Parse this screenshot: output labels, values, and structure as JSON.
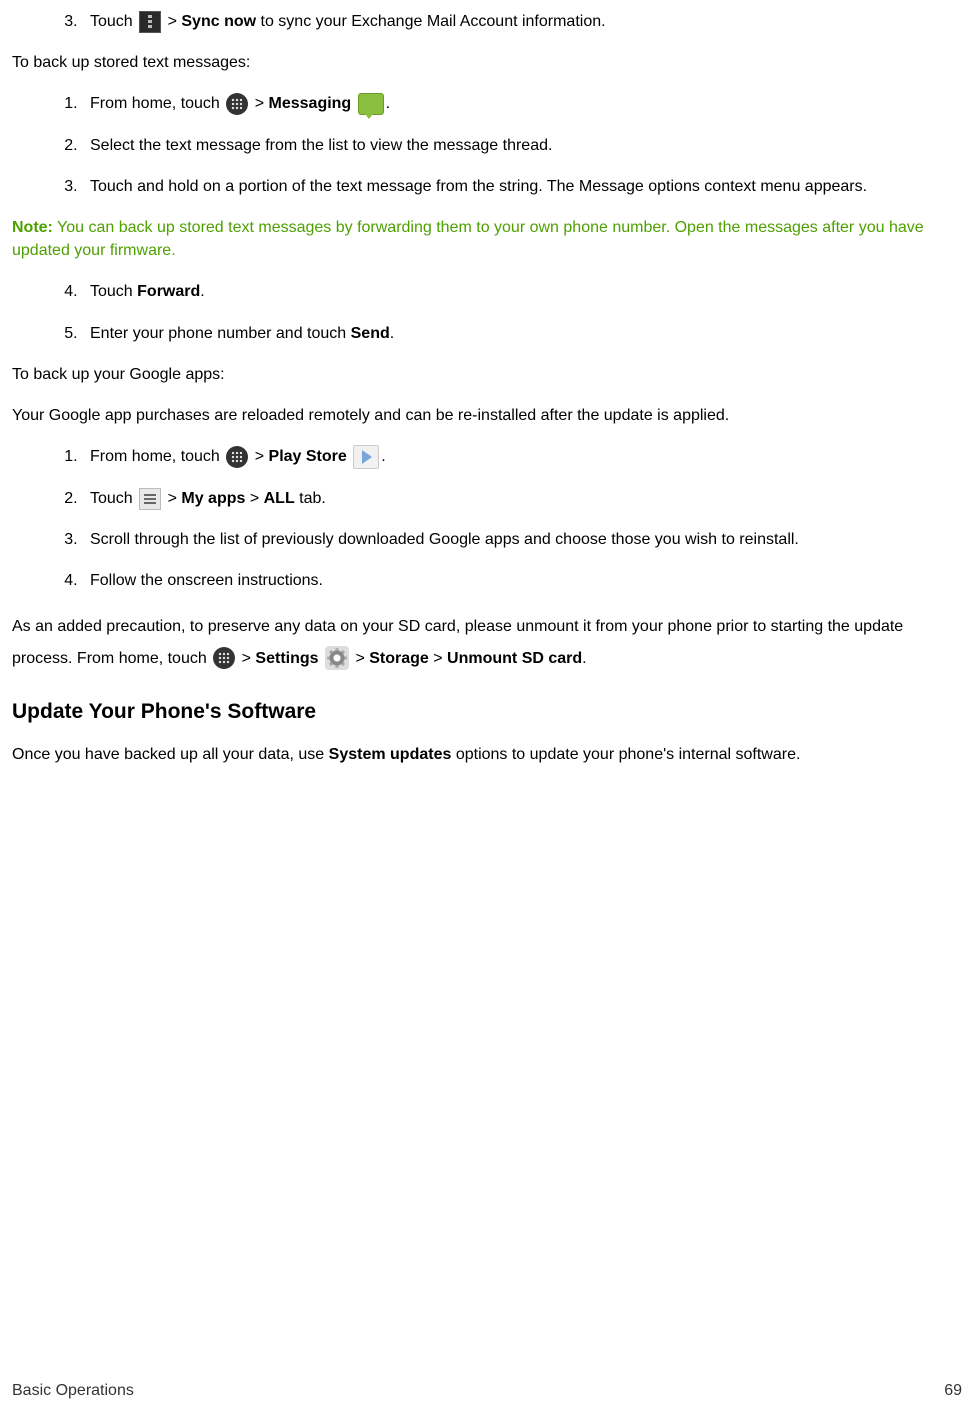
{
  "list1": {
    "start": 3,
    "item3_a": "Touch ",
    "item3_b": " > ",
    "item3_sync": "Sync now",
    "item3_c": " to sync your Exchange Mail Account information."
  },
  "p_backup_text": "To back up stored text messages:",
  "list2": {
    "item1_a": "From home, touch ",
    "item1_b": " > ",
    "item1_msg": "Messaging",
    "item1_c": " ",
    "item1_d": ".",
    "item2": "Select the text message from the list to view the message thread.",
    "item3": "Touch and hold on a portion of the text message from the string. The Message options context menu appears."
  },
  "note": {
    "label": "Note:",
    "text": " You can back up stored text messages by forwarding them to your own phone number. Open the messages after you have updated your firmware."
  },
  "list3": {
    "start": 4,
    "item4_a": "Touch ",
    "item4_fwd": "Forward",
    "item4_b": ".",
    "item5_a": "Enter your phone number and touch ",
    "item5_send": "Send",
    "item5_b": "."
  },
  "p_backup_google": "To back up your Google apps:",
  "p_google_desc": "Your Google app purchases are reloaded remotely and can be re-installed after the update is applied.",
  "list4": {
    "item1_a": "From home, touch ",
    "item1_b": " > ",
    "item1_play": "Play Store",
    "item1_c": " ",
    "item1_d": ".",
    "item2_a": "Touch ",
    "item2_b": " > ",
    "item2_myapps": "My apps",
    "item2_c": " > ",
    "item2_all": "ALL",
    "item2_d": " tab.",
    "item3": "Scroll through the list of previously downloaded Google apps and choose those you wish to reinstall.",
    "item4": "Follow the onscreen instructions."
  },
  "p_sd_a": "As an added precaution, to preserve any data on your SD card, please unmount it from your phone prior to starting the update process. From home, touch ",
  "p_sd_b": " > ",
  "p_sd_settings": "Settings",
  "p_sd_c": " ",
  "p_sd_d": " > ",
  "p_sd_storage": "Storage",
  "p_sd_e": " > ",
  "p_sd_unmount": "Unmount SD card",
  "p_sd_f": ".",
  "heading": "Update Your Phone's Software",
  "p_update_a": "Once you have backed up all your data, use ",
  "p_update_sys": "System updates",
  "p_update_b": " options to update your phone's internal software.",
  "footer": {
    "title": "Basic Operations",
    "page": "69"
  }
}
